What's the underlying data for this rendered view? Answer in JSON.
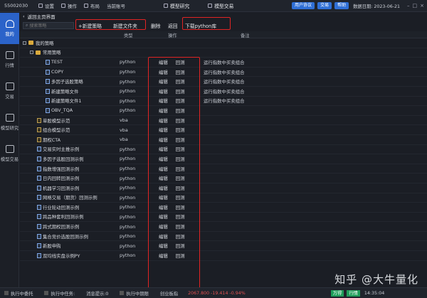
{
  "topbar": {
    "account": "55002030",
    "menu": [
      "设置",
      "操作",
      "布局",
      "当前账号"
    ],
    "modules": [
      "模型研究",
      "模型交易"
    ],
    "buttons": [
      "用户协议",
      "交易",
      "帮助"
    ],
    "date": "数据日期: 2023-06-21"
  },
  "leftnav": [
    {
      "label": "我的",
      "icon": "home-icon"
    },
    {
      "label": "行情",
      "icon": "chart-icon"
    },
    {
      "label": "交易",
      "icon": "trade-icon"
    },
    {
      "label": "模型研究",
      "icon": "research-icon"
    },
    {
      "label": "模型交易",
      "icon": "model-trade-icon"
    }
  ],
  "title": "返回主页界面",
  "toolbar": {
    "search_placeholder": "搜索策略",
    "new_strategy": "+新建策略",
    "new_folder": "新建文件夹",
    "delete": "删除",
    "back": "返回",
    "download": "下载python库"
  },
  "columns": {
    "type": "类型",
    "action": "操作",
    "note": "备注"
  },
  "tree": {
    "root": "我的策略",
    "folder": "常用策略",
    "edit_label": "编辑",
    "backtest_label": "回测",
    "folder_items": [
      {
        "name": "TEST",
        "type": "python",
        "note": "运行指数中买卖组合"
      },
      {
        "name": "COPY",
        "type": "python",
        "note": "运行指数中买卖组合"
      },
      {
        "name": "多因子选股策略",
        "type": "python",
        "note": "运行指数中买卖组合"
      },
      {
        "name": "新建策略文件",
        "type": "python",
        "note": "运行指数中买卖组合"
      },
      {
        "name": "新建策略文件1",
        "type": "python",
        "note": "运行指数中买卖组合"
      },
      {
        "name": "OBV_TQA",
        "type": "python",
        "note": ""
      }
    ],
    "root_items": [
      {
        "name": "单股模型示范",
        "type": "vba"
      },
      {
        "name": "组合模型示范",
        "type": "vba"
      },
      {
        "name": "期权CTA",
        "type": "vba"
      },
      {
        "name": "交易实时主推示例",
        "type": "python"
      },
      {
        "name": "多因子选股回测示例",
        "type": "python"
      },
      {
        "name": "指数增强回测示例",
        "type": "python"
      },
      {
        "name": "日内回转回测示例",
        "type": "python"
      },
      {
        "name": "机器学习回测示例",
        "type": "python"
      },
      {
        "name": "网格交易（期货）回测示例",
        "type": "python"
      },
      {
        "name": "行业轮动回测示例",
        "type": "python"
      },
      {
        "name": "跨品种套利回测示例",
        "type": "python"
      },
      {
        "name": "跨式期权回测示例",
        "type": "python"
      },
      {
        "name": "集合竞价选股回测示例",
        "type": "python"
      },
      {
        "name": "新股申购",
        "type": "python"
      },
      {
        "name": "双均线实盘示例PY",
        "type": "python"
      }
    ]
  },
  "statusbar": {
    "items": [
      "执行中委托",
      "执行中任务:",
      "消息提示:0",
      "执行中期限",
      "创业板指"
    ],
    "quote": "2067.800 -19.414 -0.94%",
    "tags": [
      "万得",
      "行情"
    ],
    "time": "14:35:04"
  },
  "watermark": "知乎 @大牛量化"
}
